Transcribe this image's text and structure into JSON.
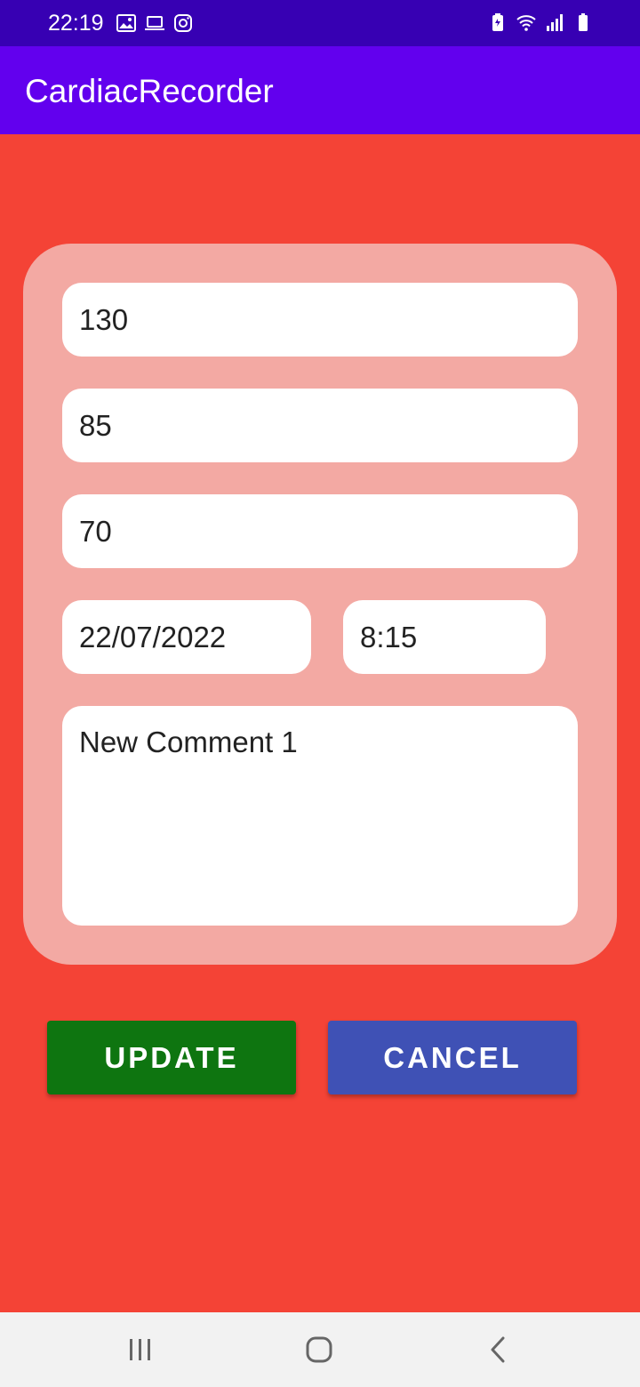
{
  "status_bar": {
    "time": "22:19",
    "icons_left": [
      "image-icon",
      "laptop-icon",
      "instagram-icon"
    ],
    "icons_right": [
      "battery-saver-icon",
      "wifi-icon",
      "signal-icon",
      "battery-icon"
    ]
  },
  "app_bar": {
    "title": "CardiacRecorder"
  },
  "form": {
    "systolic": "130",
    "diastolic": "85",
    "heart_rate": "70",
    "date": "22/07/2022",
    "time": "8:15",
    "comment": "New Comment 1"
  },
  "buttons": {
    "update_label": "UPDATE",
    "cancel_label": "CANCEL"
  },
  "nav_bar": {
    "icons": [
      "recents-icon",
      "home-icon",
      "back-icon"
    ]
  },
  "colors": {
    "status_bar": "#3700b3",
    "app_bar": "#6200ee",
    "background": "#f44336",
    "card": "#f3a9a3",
    "update_button": "#0e7510",
    "cancel_button": "#3f51b5"
  }
}
